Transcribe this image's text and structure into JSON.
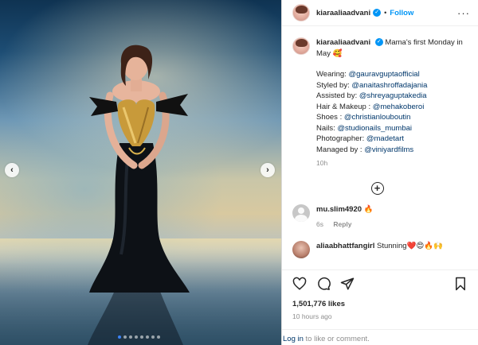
{
  "photo": {
    "nav_prev_icon": "chevron-left-icon",
    "nav_next_icon": "chevron-right-icon",
    "nav_prev_glyph": "‹",
    "nav_next_glyph": "›",
    "carousel_position": {
      "current": 1,
      "total": 8
    }
  },
  "header": {
    "username": "kiaraaliaadvani",
    "separator": "•",
    "follow_label": "Follow",
    "more_glyph": "···"
  },
  "caption": {
    "username": "kiaraaliaadvani",
    "text": "Mama's first Monday in May 🥰",
    "lines": [
      {
        "label": "Wearing: ",
        "mention": "@gauravguptaofficial"
      },
      {
        "label": "Styled by: ",
        "mention": "@anaitashroffadajania"
      },
      {
        "label": "Assisted by: ",
        "mention": "@shreyaguptakedia"
      },
      {
        "label": "Hair & Makeup : ",
        "mention": "@mehakoberoi"
      },
      {
        "label": "Shoes : ",
        "mention": "@christianlouboutin"
      },
      {
        "label": "Nails: ",
        "mention": "@studionails_mumbai"
      },
      {
        "label": "Photographer: ",
        "mention": "@madetart"
      },
      {
        "label": "Managed by : ",
        "mention": "@viniyardfilms"
      }
    ],
    "time": "10h"
  },
  "load_more_glyph": "+",
  "comments": [
    {
      "username": "mu.slim4920",
      "text": "🔥",
      "time": "6s",
      "reply_label": "Reply"
    },
    {
      "username": "aliaabhattfangirl",
      "text": "Stunning❤️😍🔥🙌",
      "time": "",
      "reply_label": ""
    }
  ],
  "likes": "1,501,776 likes",
  "posted": "10 hours ago",
  "login": {
    "link": "Log in",
    "rest": " to like or comment."
  },
  "icons": {
    "like": "heart-icon",
    "comment": "comment-icon",
    "share": "share-icon",
    "save": "bookmark-icon"
  },
  "colors": {
    "accent": "#0095f6",
    "mention": "#00376b",
    "muted": "#8e8e8e",
    "carousel_active_dot": "#3b82f6"
  }
}
